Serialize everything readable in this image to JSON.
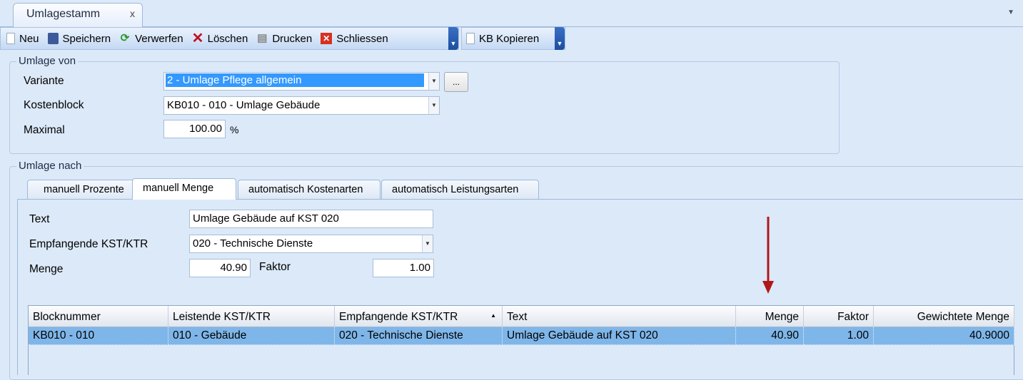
{
  "tab": {
    "title": "Umlagestamm",
    "close": "x"
  },
  "toolbar": {
    "items": [
      {
        "label": "Neu",
        "icon": "new-document-icon"
      },
      {
        "label": "Speichern",
        "icon": "save-icon"
      },
      {
        "label": "Verwerfen",
        "icon": "discard-icon"
      },
      {
        "label": "Löschen",
        "icon": "delete-icon"
      },
      {
        "label": "Drucken",
        "icon": "print-icon"
      },
      {
        "label": "Schliessen",
        "icon": "close-icon"
      }
    ],
    "kb_kopieren": "KB Kopieren"
  },
  "umlage_von": {
    "title": "Umlage von",
    "variante_label": "Variante",
    "variante_value": "2 - Umlage Pflege allgemein",
    "browse": "...",
    "kostenblock_label": "Kostenblock",
    "kostenblock_value": "KB010 - 010 - Umlage Gebäude",
    "maximal_label": "Maximal",
    "maximal_value": "100.00",
    "percent": "%"
  },
  "umlage_nach": {
    "title": "Umlage nach",
    "tabs": [
      "manuell Prozente",
      "manuell Menge",
      "automatisch Kostenarten",
      "automatisch Leistungsarten"
    ],
    "active_tab": "manuell Menge",
    "text_label": "Text",
    "text_value": "Umlage Gebäude auf KST 020",
    "empf_label": "Empfangende KST/KTR",
    "empf_value": "020 - Technische Dienste",
    "menge_label": "Menge",
    "menge_value": "40.90",
    "faktor_label": "Faktor",
    "faktor_value": "1.00"
  },
  "grid": {
    "columns": [
      "Blocknummer",
      "Leistende KST/KTR",
      "Empfangende KST/KTR",
      "Text",
      "Menge",
      "Faktor",
      "Gewichtete Menge"
    ],
    "sort_column": "Empfangende KST/KTR",
    "sort_dir": "ascending",
    "rows": [
      [
        "KB010 - 010",
        "010 - Gebäude",
        "020 - Technische Dienste",
        "Umlage Gebäude auf KST 020",
        "40.90",
        "1.00",
        "40.9000"
      ]
    ]
  },
  "colors": {
    "background": "#dce9f9",
    "selection": "#3399ff",
    "row_selected": "#7fb6e9",
    "arrow": "#b01818"
  }
}
